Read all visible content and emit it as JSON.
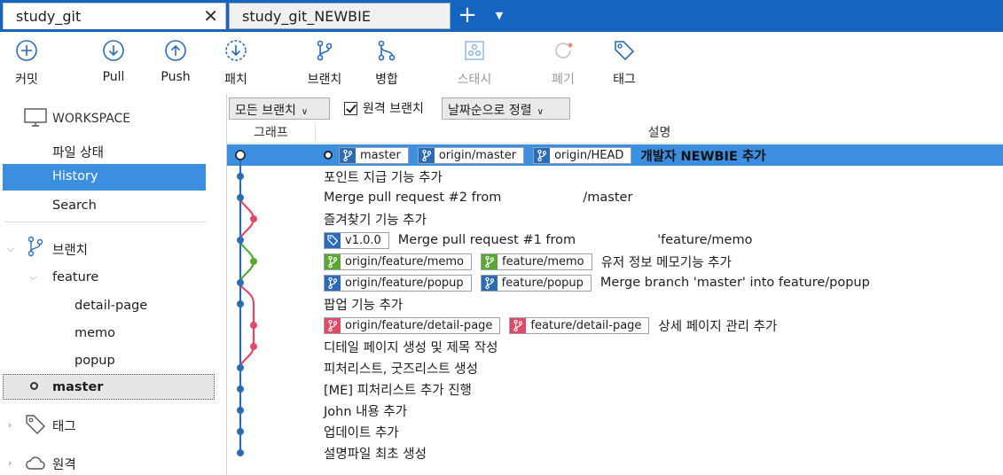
{
  "tabs": [
    {
      "label": "study_git",
      "active": true
    },
    {
      "label": "study_git_NEWBIE",
      "active": false
    }
  ],
  "toolbar": {
    "commit": "커밋",
    "pull": "Pull",
    "push": "Push",
    "patch": "패치",
    "branch": "브랜치",
    "merge": "병합",
    "stash": "스태시",
    "discard": "폐기",
    "tag": "태그"
  },
  "sidebar": {
    "workspace": "WORKSPACE",
    "file_status": "파일 상태",
    "history": "History",
    "search": "Search",
    "branches_header": "브랜치",
    "feature_folder": "feature",
    "feature_items": [
      "detail-page",
      "memo",
      "popup"
    ],
    "master": "master",
    "tags_header": "태그",
    "remotes_header": "원격"
  },
  "filters": {
    "all_branches": "모든 브랜치",
    "remote_branches": "원격 브랜치",
    "sort": "날짜순으로 정렬"
  },
  "columns": {
    "graph": "그래프",
    "description": "설명"
  },
  "commits": [
    {
      "message": "개발자 NEWBIE 추가",
      "refs": [
        {
          "name": "master",
          "color": "blue"
        },
        {
          "name": "origin/master",
          "color": "blue"
        },
        {
          "name": "origin/HEAD",
          "color": "blue"
        }
      ],
      "head": true,
      "selected": true
    },
    {
      "message": "포인트 지급 기능 추가",
      "refs": []
    },
    {
      "message_pre": "Merge pull request #2 from",
      "message_post": "/master",
      "refs": []
    },
    {
      "message": "즐겨찾기 기능 추가",
      "refs": []
    },
    {
      "message_pre": "Merge pull request #1 from",
      "message_post": "'feature/memo",
      "refs": [
        {
          "name": "v1.0.0",
          "color": "tag"
        }
      ]
    },
    {
      "message": "유저 정보 메모기능 추가",
      "refs": [
        {
          "name": "origin/feature/memo",
          "color": "green"
        },
        {
          "name": "feature/memo",
          "color": "green"
        }
      ]
    },
    {
      "message": "Merge branch 'master' into feature/popup",
      "refs": [
        {
          "name": "origin/feature/popup",
          "color": "blue"
        },
        {
          "name": "feature/popup",
          "color": "blue"
        }
      ]
    },
    {
      "message": "팝업 기능 추가",
      "refs": []
    },
    {
      "message": "상세 페이지 관리 추가",
      "refs": [
        {
          "name": "origin/feature/detail-page",
          "color": "red"
        },
        {
          "name": "feature/detail-page",
          "color": "red"
        }
      ]
    },
    {
      "message": "디테일 페이지 생성 및 제목 작성",
      "refs": []
    },
    {
      "message": "피처리스트, 굿즈리스트 생성",
      "refs": []
    },
    {
      "message": "[ME] 피처리스트 추가 진행",
      "refs": []
    },
    {
      "message": "John 내용 추가",
      "refs": []
    },
    {
      "message": "업데이트 추가",
      "refs": []
    },
    {
      "message": "설명파일 최초 생성",
      "refs": []
    }
  ],
  "colors": {
    "accent": "#1565c0",
    "selection": "#3c8ee0",
    "graph_blue": "#2c6cb5",
    "graph_red": "#e04a66",
    "graph_green": "#5aa832"
  }
}
